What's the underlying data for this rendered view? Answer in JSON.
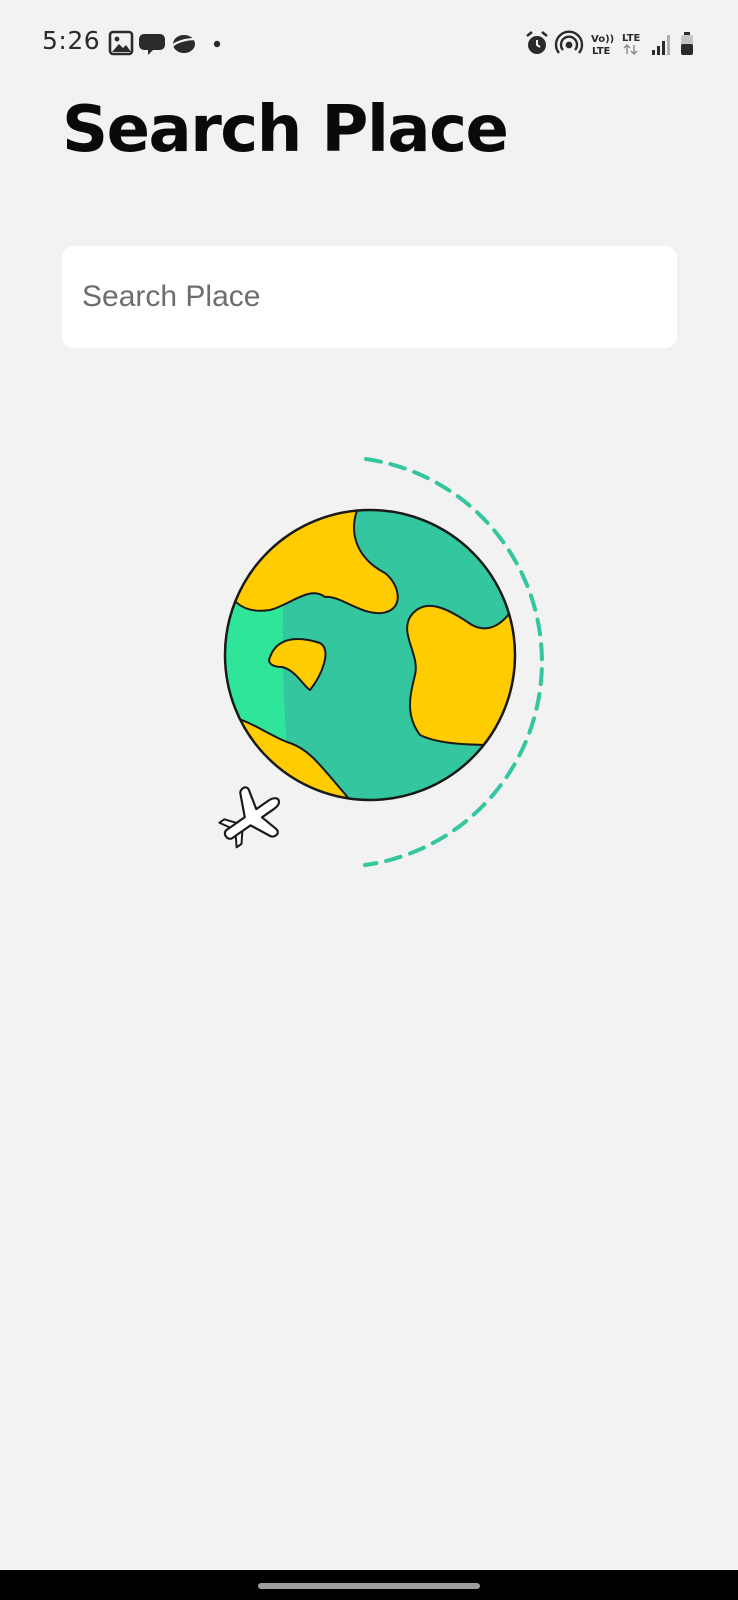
{
  "status_bar": {
    "time": "5:26",
    "left_icons": [
      "gallery-icon",
      "chat-bubble-icon",
      "planet-icon",
      "notification-dot-icon"
    ],
    "right_icons": [
      "alarm-icon",
      "hotspot-icon",
      "volte-icon",
      "lte-icon",
      "signal-icon",
      "battery-icon"
    ],
    "volte_label_top": "Vo))",
    "volte_label_bottom": "LTE",
    "lte_label": "LTE"
  },
  "page": {
    "title": "Search Place"
  },
  "search": {
    "placeholder": "Search Place",
    "value": ""
  },
  "illustration": {
    "name": "globe-with-airplane",
    "colors": {
      "ocean": "#33c69f",
      "ocean_light": "#2ee59a",
      "land": "#ffcc00",
      "orbit": "#33c69f",
      "outline": "#1a1a1a"
    }
  },
  "colors": {
    "background": "#f2f2f2",
    "search_box": "#ffffff",
    "title": "#0a0a0a",
    "nav_bar": "#000000"
  }
}
